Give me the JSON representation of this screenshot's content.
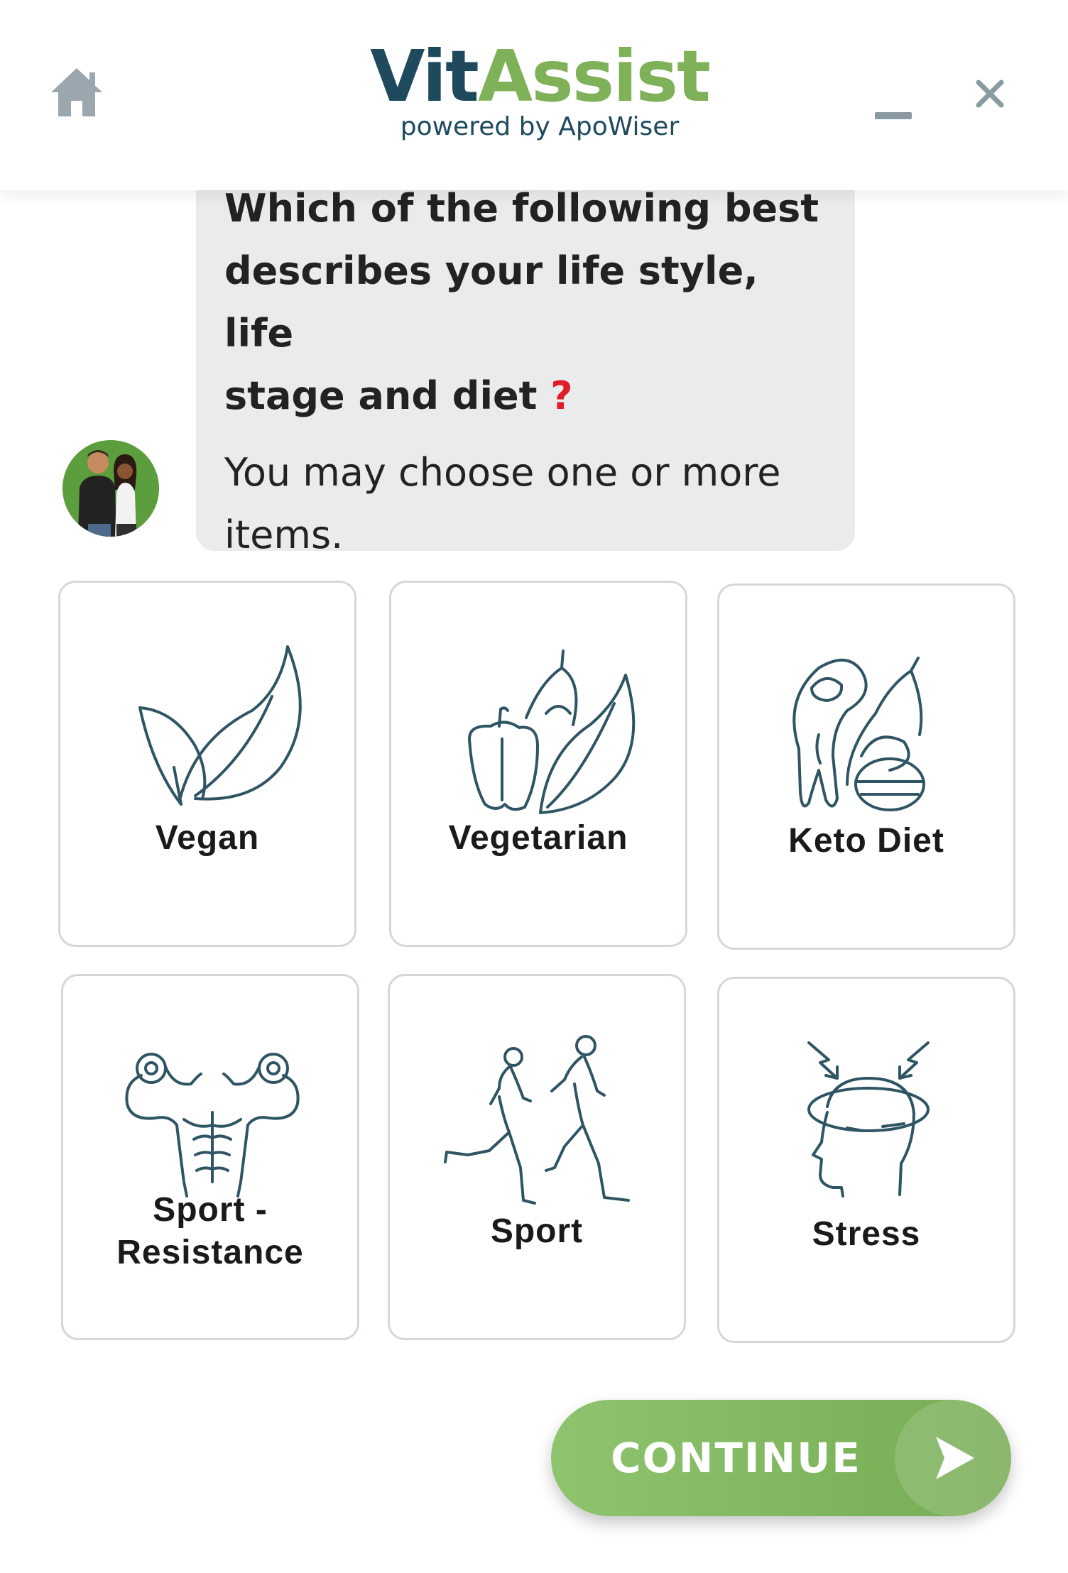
{
  "header": {
    "brand_part1": "Vit",
    "brand_part2": "Assist",
    "tagline": "powered by ApoWiser",
    "home_icon": "home-icon",
    "minimize_icon": "minimize-icon",
    "close_icon": "close-icon"
  },
  "chat": {
    "question_line1": "Which of the following best",
    "question_line2": "describes your life style, life",
    "question_line3": "stage and diet",
    "question_mark": "?",
    "instruction_line1": "You may choose one or more",
    "instruction_line2": "items.",
    "avatar_icon": "couple-avatar-icon"
  },
  "options": [
    {
      "label": "Vegan",
      "icon": "leaves-icon"
    },
    {
      "label": "Vegetarian",
      "icon": "vegetables-icon"
    },
    {
      "label": "Keto Diet",
      "icon": "keto-food-icon"
    },
    {
      "label_line1": "Sport -",
      "label_line2": "Resistance",
      "icon": "muscle-icon"
    },
    {
      "label": "Sport",
      "icon": "runners-icon"
    },
    {
      "label": "Stress",
      "icon": "stressed-head-icon"
    }
  ],
  "continue_button": {
    "label": "CONTINUE",
    "icon": "arrow-right-icon"
  },
  "colors": {
    "brand_dark": "#1f4a5e",
    "brand_green": "#7fb158",
    "icon_stroke": "#2f5564",
    "bubble_bg": "#e9ebed",
    "question_mark": "#e01e2a",
    "card_border": "#d4d8da"
  }
}
